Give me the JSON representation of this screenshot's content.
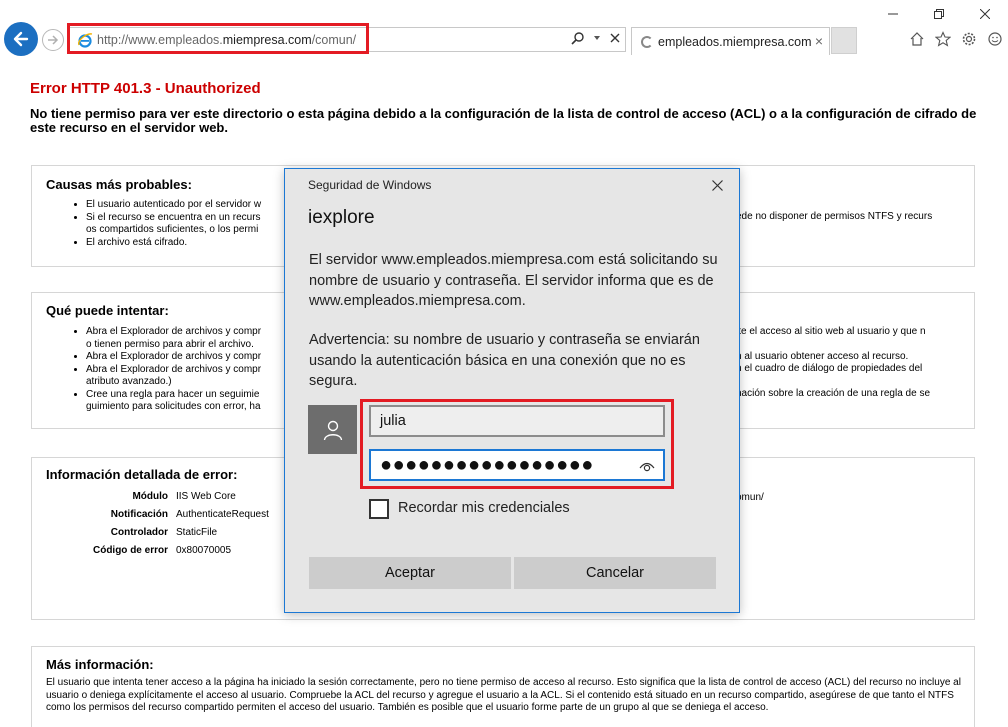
{
  "browser": {
    "url_prefix": "http://www.empleados.",
    "url_domain": "miempresa.com",
    "url_path": "/comun/",
    "tab_title": "empleados.miempresa.com",
    "tab_close": "×"
  },
  "page": {
    "title": "Error HTTP 401.3 - Unauthorized",
    "description": "No tiene permiso para ver este directorio o esta página debido a la configuración de la lista de control de acceso (ACL) o a la configuración de cifrado de este recurso en el servidor web.",
    "causes": {
      "heading": "Causas más probables:",
      "items": [
        "El usuario autenticado por el servidor w",
        "Si el recurso se encuentra en un recurs",
        "os compartidos suficientes, o los permi",
        "El archivo está cifrado."
      ],
      "right_fragment": "ede no disponer de permisos NTFS y recurs"
    },
    "try": {
      "heading": "Qué puede intentar:",
      "items": [
        "Abra el Explorador de archivos y compr",
        "o tienen permiso para abrir el archivo.",
        "Abra el Explorador de archivos y compr",
        "Abra el Explorador de archivos y compr",
        "atributo avanzado.)",
        "Cree una regla para hacer un seguimie",
        "guimiento para solicitudes con error, ha"
      ],
      "right_fragments": [
        "ite el acceso al sitio web al usuario y que n",
        "n al usuario obtener acceso al recurso.",
        "n el cuadro de diálogo de propiedades del",
        "nación sobre la creación de una regla de se"
      ]
    },
    "detail": {
      "heading": "Información detallada de error:",
      "rows": [
        {
          "key": "Módulo",
          "value": "IIS Web Core"
        },
        {
          "key": "Notificación",
          "value": "AuthenticateRequest"
        },
        {
          "key": "Controlador",
          "value": "StaticFile"
        },
        {
          "key": "Código de error",
          "value": "0x80070005"
        }
      ],
      "right_fragment": "omun/"
    },
    "more": {
      "heading": "Más información:",
      "text": "El usuario que intenta tener acceso a la página ha iniciado la sesión correctamente, pero no tiene permiso de acceso al recurso. Esto significa que la lista de control de acceso (ACL) del recurso no incluye al usuario o deniega explícitamente el acceso al usuario. Compruebe la ACL del recurso y agregue el usuario a la ACL. Si el contenido está situado en un recurso compartido, asegúrese de que tanto el NTFS como los permisos del recurso compartido permiten el acceso del usuario. También es posible que el usuario forme parte de un grupo al que se deniega el acceso."
    }
  },
  "dialog": {
    "caption": "Seguridad de Windows",
    "app": "iexplore",
    "message": "El servidor www.empleados.miempresa.com está solicitando su nombre de usuario y contraseña. El servidor informa que es de www.empleados.miempresa.com.",
    "warning": "Advertencia: su nombre de usuario y contraseña se enviarán usando la autenticación básica en una conexión que no es segura.",
    "username": "julia",
    "password_mask": "●●●●●●●●●●●●●●●●●",
    "remember_label": "Recordar mis credenciales",
    "remember_checked": false,
    "ok_label": "Aceptar",
    "cancel_label": "Cancelar"
  },
  "colors": {
    "error_title": "#cc0000",
    "highlight": "#e31b23",
    "accent": "#1c78d4",
    "back_button": "#1c6fc1"
  }
}
